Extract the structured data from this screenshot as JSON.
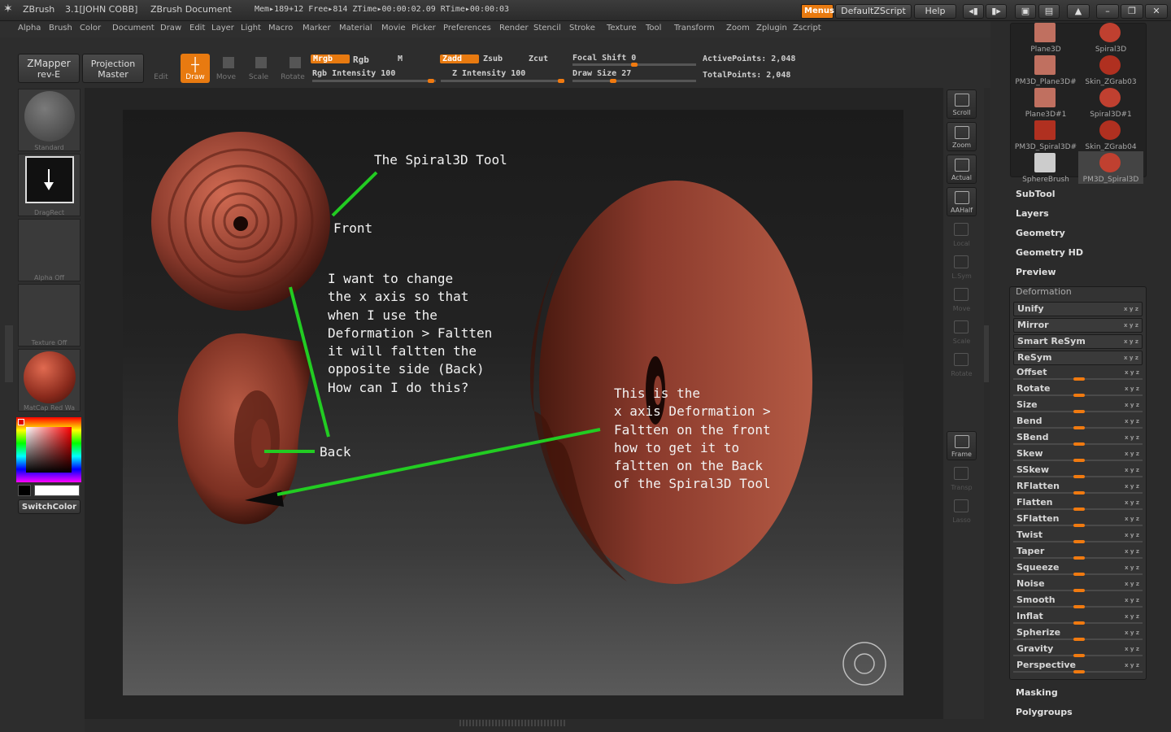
{
  "title_bar": {
    "app": "ZBrush",
    "version": "3.1[JOHN COBB]",
    "document": "ZBrush Document",
    "stats": "Mem▸189+12 Free▸814 ZTime▸00:00:02.09 RTime▸00:00:03",
    "menus_btn": "Menus",
    "script_btn": "DefaultZScript",
    "help_btn": "Help"
  },
  "menu_items": [
    "Alpha",
    "Brush",
    "Color",
    "Document",
    "Draw",
    "Edit",
    "Layer",
    "Light",
    "Macro",
    "Marker",
    "Material",
    "Movie",
    "Picker",
    "Preferences",
    "Render",
    "Stencil",
    "Stroke",
    "Texture",
    "Tool",
    "Transform",
    "Zoom",
    "Zplugin",
    "Zscript"
  ],
  "toolbar": {
    "zmapper_line1": "ZMapper",
    "zmapper_line2": "rev-E",
    "projection_line1": "Projection",
    "projection_line2": "Master",
    "edit": "Edit",
    "draw": "Draw",
    "move": "Move",
    "scale": "Scale",
    "rotate": "Rotate",
    "mrgb": "Mrgb",
    "rgb": "Rgb",
    "m": "M",
    "rgb_intensity": "Rgb Intensity 100",
    "zadd": "Zadd",
    "zsub": "Zsub",
    "zcut": "Zcut",
    "z_intensity": "Z Intensity 100",
    "focal_shift": "Focal Shift 0",
    "draw_size": "Draw Size 27",
    "active_points": "ActivePoints: 2,048",
    "total_points": "TotalPoints: 2,048"
  },
  "left_panel": {
    "brush": "Standard",
    "stroke": "DragRect",
    "alpha": "Alpha Off",
    "texture": "Texture Off",
    "material": "MatCap Red Wa",
    "switch_color": "SwitchColor"
  },
  "canvas_notes": {
    "title": "The Spiral3D Tool",
    "front": "Front",
    "back": "Back",
    "question": "I want to change\nthe x axis so that\nwhen I use the\nDeformation > Faltten\nit will faltten the\nopposite side (Back)\nHow can I do this?",
    "explanation": "This is the\nx axis Deformation >\nFaltten on the front\nhow to get it to\nfaltten on the Back\nof the Spiral3D Tool"
  },
  "right_tools": [
    "Scroll",
    "Zoom",
    "Actual",
    "AAHalf",
    "Local",
    "L.Sym",
    "Move",
    "Scale",
    "Rotate",
    "Frame",
    "Transp",
    "Lasso"
  ],
  "tool_thumbs": [
    "Plane3D",
    "Spiral3D",
    "PM3D_Plane3D#",
    "Skin_ZGrab03",
    "Plane3D#1",
    "Spiral3D#1",
    "PM3D_Spiral3D#",
    "Skin_ZGrab04",
    "SphereBrush",
    "PM3D_Spiral3D"
  ],
  "tool_sections_top": [
    "SubTool",
    "Layers",
    "Geometry",
    "Geometry HD",
    "Preview"
  ],
  "deformation": {
    "header": "Deformation",
    "boxed": [
      "Unify",
      "Mirror",
      "Smart ReSym",
      "ReSym"
    ],
    "sliders": [
      "Offset",
      "Rotate",
      "Size",
      "Bend",
      "SBend",
      "Skew",
      "SSkew",
      "RFlatten",
      "Flatten",
      "SFlatten",
      "Twist",
      "Taper",
      "Squeeze",
      "Noise",
      "Smooth",
      "Inflat",
      "Spherize",
      "Gravity",
      "Perspective"
    ]
  },
  "tool_sections_bottom": [
    "Masking",
    "Polygroups"
  ],
  "colors": {
    "accent": "#e87a10",
    "annotation": "#22cc22",
    "model": "#8a3a2c"
  }
}
